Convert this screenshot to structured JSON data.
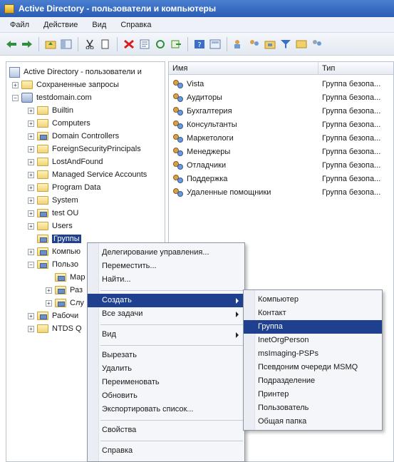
{
  "window": {
    "title": "Active Directory - пользователи и компьютеры"
  },
  "menu": [
    "Файл",
    "Действие",
    "Вид",
    "Справка"
  ],
  "tree": {
    "root": "Active Directory - пользователи и",
    "saved_queries": "Сохраненные запросы",
    "domain": "testdomain.com",
    "children": [
      "Builtin",
      "Computers",
      "Domain Controllers",
      "ForeignSecurityPrincipals",
      "LostAndFound",
      "Managed Service Accounts",
      "Program Data",
      "System",
      "test OU",
      "Users",
      "Группы",
      "Компью",
      "Пользо",
      "Мар",
      "Раз",
      "Слу",
      "Рабочи",
      "NTDS Q"
    ]
  },
  "list": {
    "columns": [
      "Имя",
      "Тип"
    ],
    "rows": [
      {
        "name": "Vista",
        "type": "Группа безопа..."
      },
      {
        "name": "Аудиторы",
        "type": "Группа безопа..."
      },
      {
        "name": "Бухгалтерия",
        "type": "Группа безопа..."
      },
      {
        "name": "Консультанты",
        "type": "Группа безопа..."
      },
      {
        "name": "Маркетологи",
        "type": "Группа безопа..."
      },
      {
        "name": "Менеджеры",
        "type": "Группа безопа..."
      },
      {
        "name": "Отладчики",
        "type": "Группа безопа..."
      },
      {
        "name": "Поддержка",
        "type": "Группа безопа..."
      },
      {
        "name": "Удаленные помощники",
        "type": "Группа безопа..."
      }
    ]
  },
  "context_menu": {
    "delegate": "Делегирование управления...",
    "move": "Переместить...",
    "find": "Найти...",
    "create": "Создать",
    "all_tasks": "Все задачи",
    "view": "Вид",
    "cut": "Вырезать",
    "delete": "Удалить",
    "rename": "Переименовать",
    "refresh": "Обновить",
    "export": "Экспортировать список...",
    "properties": "Свойства",
    "help": "Справка"
  },
  "submenu": [
    "Компьютер",
    "Контакт",
    "Группа",
    "InetOrgPerson",
    "msImaging-PSPs",
    "Псевдоним очереди MSMQ",
    "Подразделение",
    "Принтер",
    "Пользователь",
    "Общая папка"
  ],
  "colors": {
    "selection": "#1f3f8f",
    "titlebar": "#2a5cb4"
  }
}
